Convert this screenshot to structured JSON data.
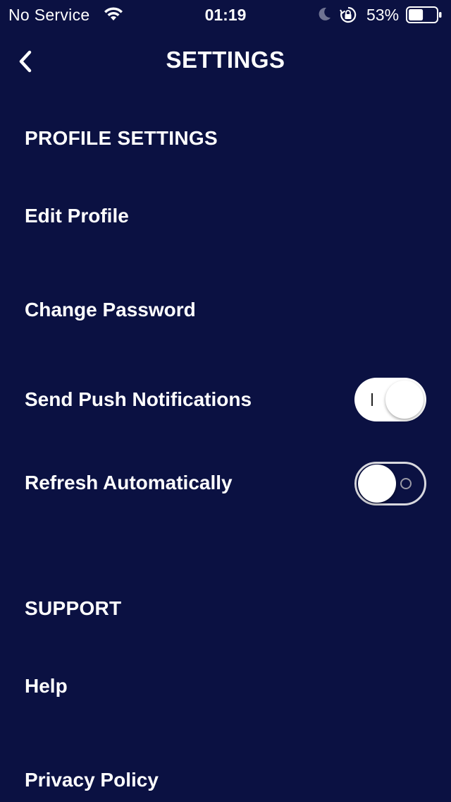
{
  "status_bar": {
    "carrier": "No Service",
    "time": "01:19",
    "battery_percent": "53%",
    "battery_level": 0.53
  },
  "header": {
    "title": "SETTINGS",
    "back_icon": "chevron-left-icon"
  },
  "sections": {
    "profile": {
      "title": "PROFILE SETTINGS",
      "edit_profile": "Edit Profile",
      "change_password": "Change Password",
      "push_notifications": {
        "label": "Send Push Notifications",
        "enabled": true
      },
      "refresh_automatically": {
        "label": "Refresh Automatically",
        "enabled": false
      }
    },
    "support": {
      "title": "SUPPORT",
      "help": "Help",
      "privacy_policy": "Privacy Policy"
    }
  },
  "colors": {
    "background": "#0b1142",
    "text": "#ffffff"
  }
}
